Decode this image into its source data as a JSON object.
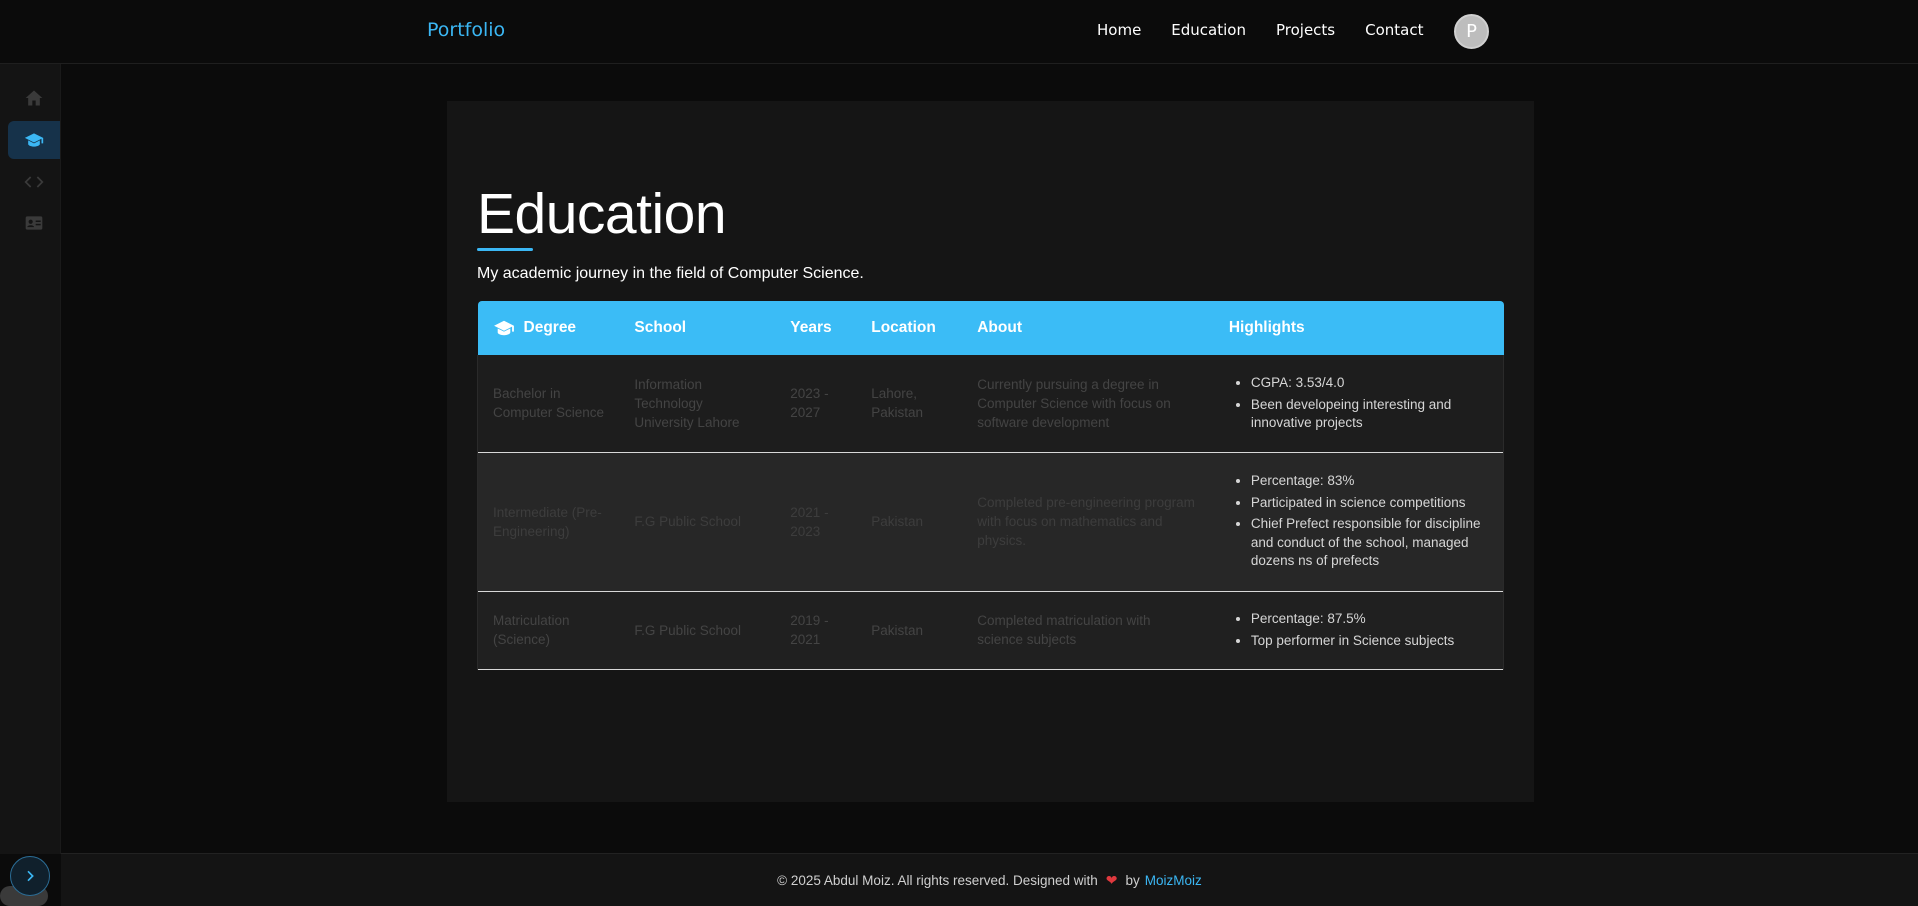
{
  "nav": {
    "brand": "Portfolio",
    "links": [
      "Home",
      "Education",
      "Projects",
      "Contact"
    ],
    "avatar_letter": "P"
  },
  "sidebar": {
    "items": [
      {
        "icon": "home-icon"
      },
      {
        "icon": "graduation-cap-icon",
        "active": true
      },
      {
        "icon": "code-icon"
      },
      {
        "icon": "contact-card-icon"
      }
    ]
  },
  "main": {
    "title": "Education",
    "subtitle": "My academic journey in the field of Computer Science.",
    "table": {
      "headers": [
        "Degree",
        "School",
        "Years",
        "Location",
        "About",
        "Highlights"
      ],
      "rows": [
        {
          "degree": "Bachelor in Computer Science",
          "school": "Information Technology University Lahore",
          "years": "2023 - 2027",
          "location": "Lahore, Pakistan",
          "about": "Currently pursuing a degree in Computer Science with focus on software development",
          "highlights": [
            "CGPA: 3.53/4.0",
            "Been developeing interesting and innovative projects"
          ]
        },
        {
          "degree": "Intermediate (Pre-Engineering)",
          "school": "F.G Public School",
          "years": "2021 - 2023",
          "location": "Pakistan",
          "about": "Completed pre-engineering program with focus on mathematics and physics.",
          "highlights": [
            "Percentage: 83%",
            "Participated in science competitions",
            "Chief Prefect responsible for discipline and conduct of the school, managed dozens ns of prefects"
          ]
        },
        {
          "degree": "Matriculation (Science)",
          "school": "F.G Public School",
          "years": "2019 - 2021",
          "location": "Pakistan",
          "about": "Completed matriculation with science subjects",
          "highlights": [
            "Percentage: 87.5%",
            "Top performer in Science subjects"
          ]
        }
      ]
    }
  },
  "footer": {
    "text": "© 2025 Abdul Moiz. All rights reserved. Designed with",
    "by": "by",
    "author_link": "MoizMoiz"
  },
  "colors": {
    "accent": "#3bb7f4",
    "header_bg": "#3bbcf6",
    "heart": "#e0393e"
  }
}
